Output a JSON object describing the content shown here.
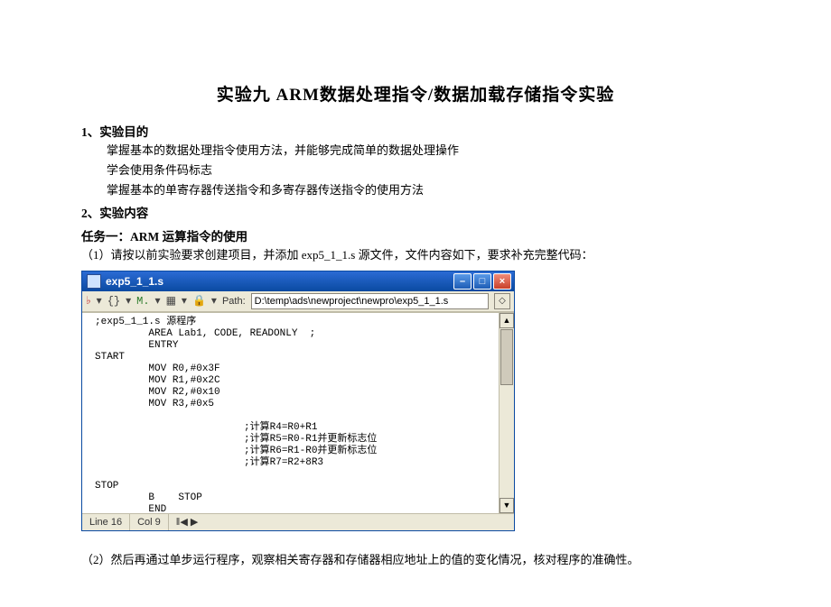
{
  "title": "实验九  ARM数据处理指令/数据加载存储指令实验",
  "s1_head": "1、实验目的",
  "s1_lines": {
    "l1": "掌握基本的数据处理指令使用方法，并能够完成简单的数据处理操作",
    "l2": "学会使用条件码标志",
    "l3": "掌握基本的单寄存器传送指令和多寄存器传送指令的使用方法"
  },
  "s2_head": "2、实验内容",
  "task1_head": "任务一：ARM 运算指令的使用",
  "task1_p1": "（1）请按以前实验要求创建项目，并添加 exp5_1_1.s 源文件，文件内容如下，要求补充完整代码：",
  "window": {
    "title": "exp5_1_1.s",
    "path_label": "Path:",
    "path_value": "D:\\temp\\ads\\newproject\\newpro\\exp5_1_1.s",
    "toolbar_icons": {
      "i1": "♭",
      "i2": "{}",
      "i3": "M.",
      "i4": "▦",
      "i5": "🔒"
    },
    "btn_min": "–",
    "btn_max": "□",
    "btn_close": "×",
    "scroll_up": "▲",
    "scroll_down": "▼",
    "go": "◇",
    "status_line": "Line 16",
    "status_col": "Col 9",
    "status_extra": "‖◀ ▶"
  },
  "code": {
    "c01": ";exp5_1_1.s 源程序",
    "c02": "         AREA Lab1, CODE, READONLY  ;",
    "c03": "         ENTRY",
    "c04": "START",
    "c05": "         MOV R0,#0x3F",
    "c06": "         MOV R1,#0x2C",
    "c07": "         MOV R2,#0x10",
    "c08": "         MOV R3,#0x5",
    "c09": "                         ;计算R4=R0+R1",
    "c10": "                         ;计算R5=R0-R1并更新标志位",
    "c11": "                         ;计算R6=R1-R0并更新标志位",
    "c12": "                         ;计算R7=R2+8R3",
    "c13": "STOP",
    "c14": "         B    STOP",
    "c15": "         END"
  },
  "task1_p2": "（2）然后再通过单步运行程序，观察相关寄存器和存储器相应地址上的值的变化情况，核对程序的准确性。"
}
